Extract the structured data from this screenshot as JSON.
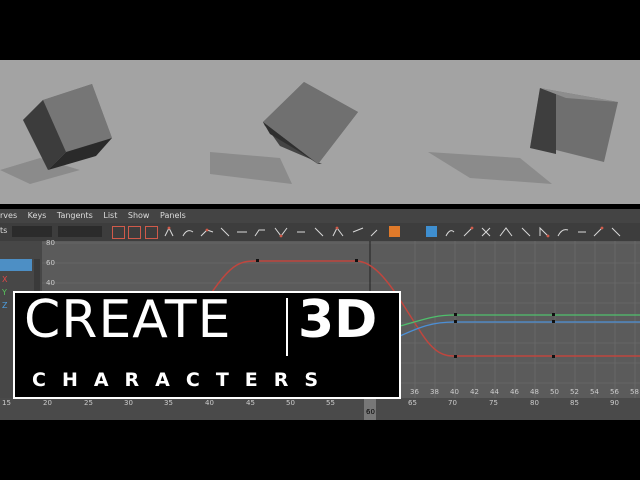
{
  "graph_editor": {
    "menu": [
      "rves",
      "Keys",
      "Tangents",
      "List",
      "Show",
      "Panels"
    ],
    "outliner_prefix": "ts",
    "axes": [
      "X",
      "Y",
      "Z"
    ],
    "y_ticks": [
      "80",
      "60",
      "40"
    ],
    "x_ticks": [
      "36",
      "38",
      "40",
      "42",
      "44",
      "46",
      "48",
      "50",
      "52",
      "54",
      "56",
      "58"
    ]
  },
  "timeline": {
    "ticks": [
      "15",
      "20",
      "25",
      "30",
      "35",
      "40",
      "45",
      "50",
      "55",
      "60",
      "65",
      "70",
      "75",
      "80",
      "85",
      "90"
    ],
    "current_frame": "60"
  },
  "overlay": {
    "word1": "CREATE",
    "word2": "3D",
    "subtitle": "CHARACTERS"
  },
  "colors": {
    "curve_red": "#c0463e",
    "curve_green": "#4fbf6c",
    "curve_blue": "#4c8fd6",
    "selected_button": "#e07a2a"
  }
}
